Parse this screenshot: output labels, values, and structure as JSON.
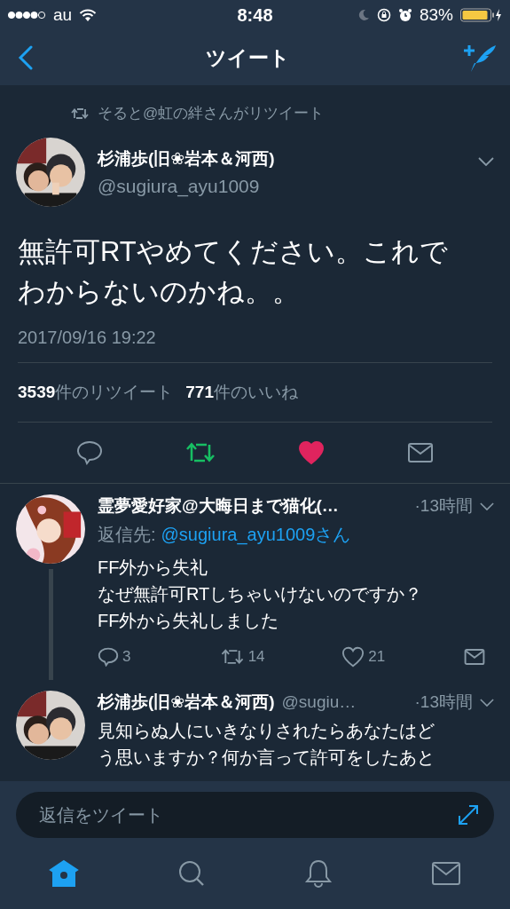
{
  "status_bar": {
    "carrier": "au",
    "time": "8:48",
    "battery": "83%"
  },
  "nav": {
    "title": "ツイート"
  },
  "retweet_context": "そると@虹の絆さんがリツイート",
  "tweet": {
    "name": "杉浦歩(旧❀岩本＆河西)",
    "handle": "@sugiura_ayu1009",
    "lines": [
      "無許可RTやめてください。これで",
      "わからないのかね。。"
    ],
    "date": "2017/09/16 19:22",
    "retweets": "**3539**件のリツイート",
    "likes": "**771**件のいいね",
    "retweeted": true,
    "liked": true
  },
  "replies": [
    {
      "name": "霊夢愛好家@大晦日まで猫化(…",
      "time": "·13時間",
      "reply_to_label": "返信先:",
      "reply_to": "@sugiura_ayu1009さん",
      "lines": [
        "FF外から失礼",
        "なぜ無許可RTしちゃいけないのですか？",
        "FF外から失礼しました"
      ],
      "thread_line": true,
      "reply_count": "3",
      "retweet_count": "14",
      "like_count": "21"
    },
    {
      "name": "杉浦歩(旧❀岩本＆河西)",
      "handle": "@sugiu…",
      "time": "·13時間",
      "lines": [
        "見知らぬ人にいきなりされたらあなたはど",
        "う思いますか？何か言って許可をしたあと"
      ],
      "thread_line": false
    }
  ],
  "composer": {
    "placeholder": "返信をツイート"
  },
  "tabs": [
    {
      "kind": "home",
      "selected": true
    },
    {
      "kind": "search",
      "selected": false
    },
    {
      "kind": "notifications",
      "selected": false
    },
    {
      "kind": "messages",
      "selected": false
    }
  ]
}
